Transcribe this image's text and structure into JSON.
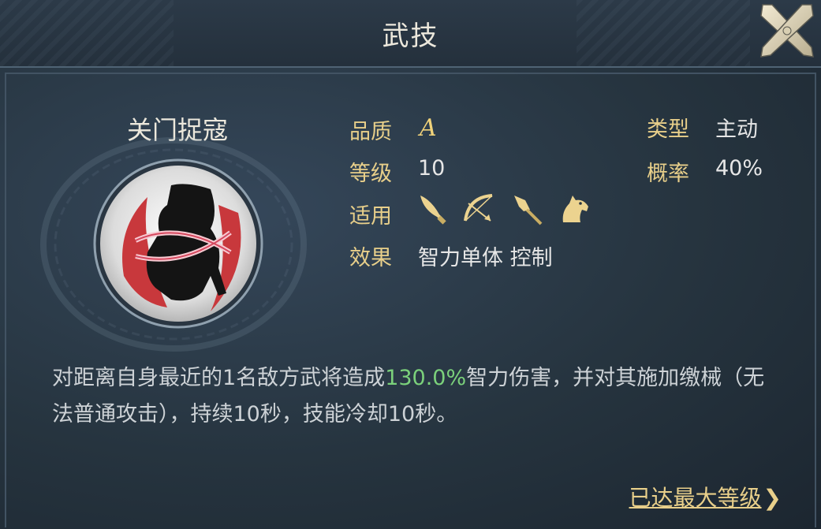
{
  "title": "武技",
  "skill": {
    "name": "关门捉寇",
    "quality_label": "品质",
    "quality": "A",
    "level_label": "等级",
    "level": "10",
    "applicable_label": "适用",
    "applicable_icons": [
      "sword-icon",
      "bow-icon",
      "spear-icon",
      "horse-icon"
    ],
    "effect_label": "效果",
    "effect": "智力单体 控制",
    "type_label": "类型",
    "type": "主动",
    "chance_label": "概率",
    "chance": "40%"
  },
  "description": {
    "before": "对距离自身最近的1名敌方武将造成",
    "highlight": "130.0%",
    "after": "智力伤害，并对其施加缴械（无法普通攻击），持续10秒，技能冷却10秒。"
  },
  "footer": {
    "max_level_link": "已达最大等级",
    "chevron": "❯"
  },
  "colors": {
    "label_gold": "#e8cf8a",
    "highlight_green": "#7bd17b",
    "background": "#26343f"
  }
}
